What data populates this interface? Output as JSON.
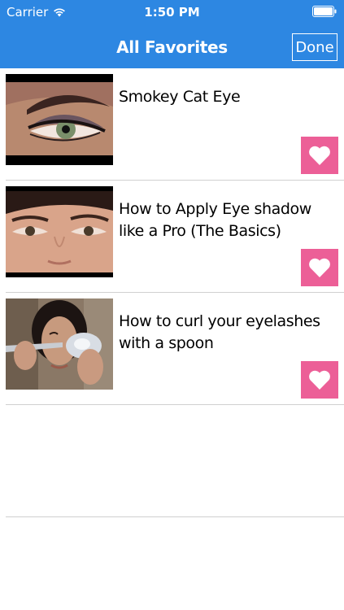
{
  "status_bar": {
    "carrier": "Carrier",
    "time": "1:50 PM"
  },
  "navbar": {
    "title": "All Favorites",
    "done_label": "Done"
  },
  "favorites": [
    {
      "title": "Smokey Cat Eye",
      "thumbnail": "smokey-eye-closeup"
    },
    {
      "title": "How to Apply Eye shadow like a Pro (The Basics)",
      "thumbnail": "eye-shadow-face"
    },
    {
      "title": "How to curl your eyelashes with a spoon",
      "thumbnail": "woman-holding-spoon"
    }
  ],
  "colors": {
    "navbar": "#2d87e2",
    "heart_button": "#ec5f97",
    "divider": "#d0d0d0"
  },
  "icons": {
    "favorite": "heart-icon",
    "wifi": "wifi-icon",
    "battery": "battery-icon"
  }
}
